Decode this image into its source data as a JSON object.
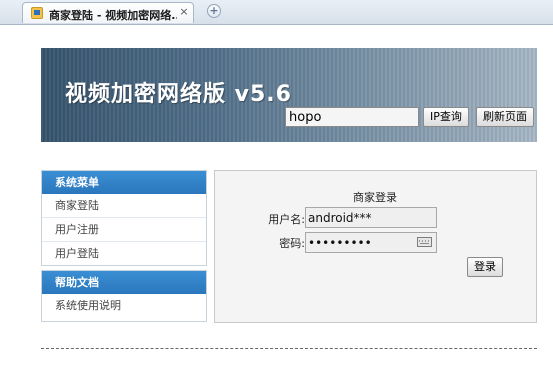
{
  "browser": {
    "tab_title": "商家登陆 - 视频加密网络...",
    "tab_close": "×",
    "new_tab": "+"
  },
  "header": {
    "title": "视频加密网络版 v5.6",
    "ip_input_value": "hopo",
    "ip_button": "IP查询",
    "refresh_button": "刷新页面"
  },
  "sidebar": {
    "menu_header": "系统菜单",
    "menu_items": [
      {
        "label": "商家登陆"
      },
      {
        "label": "用户注册"
      },
      {
        "label": "用户登陆"
      }
    ],
    "help_header": "帮助文档",
    "help_items": [
      {
        "label": "系统使用说明"
      }
    ]
  },
  "login": {
    "title": "商家登录",
    "username_label": "用户名:",
    "username_value": "android***",
    "password_label": "密码:",
    "password_value": "•••••••••",
    "submit": "登录"
  },
  "colors": {
    "section_header": "#2a76bd",
    "banner_dark": "#36546e",
    "banner_light": "#a7b7c5"
  }
}
